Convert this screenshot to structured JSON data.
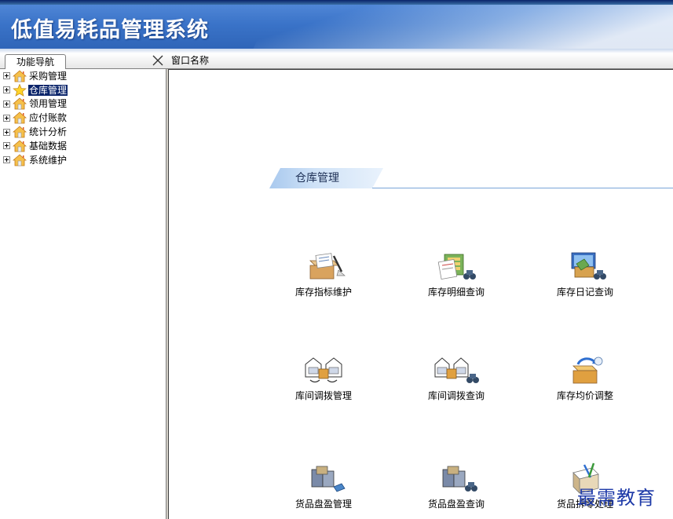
{
  "app": {
    "title": "低值易耗品管理系统",
    "accent_color": "#3a73c8"
  },
  "nav": {
    "tab_label": "功能导航",
    "close_icon": "close-x-icon",
    "window_label": "窗口名称",
    "items": [
      {
        "label": "采购管理",
        "icon": "house-icon",
        "selected": false
      },
      {
        "label": "仓库管理",
        "icon": "star-icon",
        "selected": true
      },
      {
        "label": "领用管理",
        "icon": "house-icon",
        "selected": false
      },
      {
        "label": "应付账款",
        "icon": "house-icon",
        "selected": false
      },
      {
        "label": "统计分析",
        "icon": "house-icon",
        "selected": false
      },
      {
        "label": "基础数据",
        "icon": "house-icon",
        "selected": false
      },
      {
        "label": "系统维护",
        "icon": "house-icon",
        "selected": false
      }
    ]
  },
  "section": {
    "title": "仓库管理"
  },
  "functions": [
    {
      "label": "库存指标维护",
      "icon": "box-pen-icon"
    },
    {
      "label": "库存明细查询",
      "icon": "ledger-binoculars-icon"
    },
    {
      "label": "库存日记查询",
      "icon": "screen-binoculars-icon"
    },
    {
      "label": "库间调拨管理",
      "icon": "warehouse-transfer-icon"
    },
    {
      "label": "库间调拨查询",
      "icon": "warehouse-transfer-binoculars-icon"
    },
    {
      "label": "库存均价调整",
      "icon": "box-cycle-icon"
    },
    {
      "label": "货品盘盈管理",
      "icon": "crates-icon"
    },
    {
      "label": "货品盘盈查询",
      "icon": "crates-binoculars-icon"
    },
    {
      "label": "货品拆零处理",
      "icon": "box-tools-icon"
    }
  ],
  "watermark": {
    "text": "最需教育"
  }
}
